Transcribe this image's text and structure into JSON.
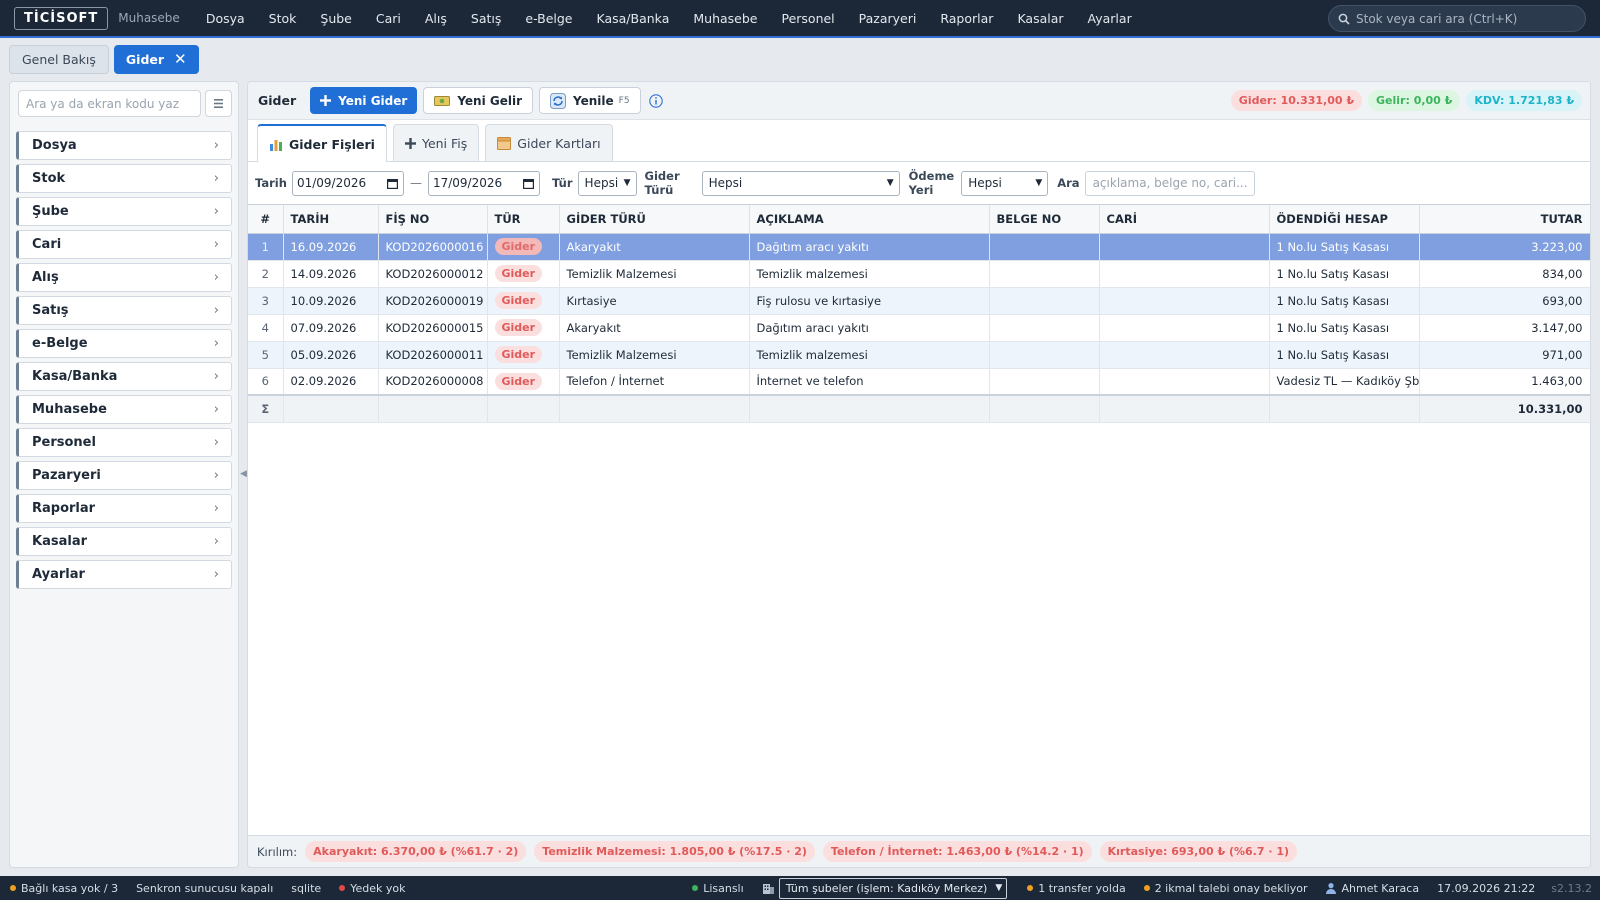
{
  "app": {
    "logo": "TİCİSOFT",
    "logo_sub": "Muhasebe"
  },
  "menu": [
    "Dosya",
    "Stok",
    "Şube",
    "Cari",
    "Alış",
    "Satış",
    "e-Belge",
    "Kasa/Banka",
    "Muhasebe",
    "Personel",
    "Pazaryeri",
    "Raporlar",
    "Kasalar",
    "Ayarlar"
  ],
  "top_search": {
    "placeholder": "Stok veya cari ara (Ctrl+K)"
  },
  "page_tabs": [
    {
      "label": "Genel Bakış"
    },
    {
      "label": "Gider",
      "close": "✕"
    }
  ],
  "sidebar": {
    "search_placeholder": "Ara ya da ekran kodu yaz",
    "items": [
      "Dosya",
      "Stok",
      "Şube",
      "Cari",
      "Alış",
      "Satış",
      "e-Belge",
      "Kasa/Banka",
      "Muhasebe",
      "Personel",
      "Pazaryeri",
      "Raporlar",
      "Kasalar",
      "Ayarlar"
    ]
  },
  "toolbar": {
    "title": "Gider",
    "new_expense": "Yeni Gider",
    "new_income": "Yeni Gelir",
    "refresh": "Yenile",
    "refresh_key": "F5"
  },
  "summary": {
    "expense": "Gider: 10.331,00 ₺",
    "income": "Gelir: 0,00 ₺",
    "vat": "KDV: 1.721,83 ₺"
  },
  "subtabs": [
    "Gider Fişleri",
    "Yeni Fiş",
    "Gider Kartları"
  ],
  "filters": {
    "date_label": "Tarih",
    "date_from": "01/09/2026",
    "date_to": "17/09/2026",
    "type_label": "Tür",
    "type_value": "Hepsi",
    "expense_type_label_1": "Gider",
    "expense_type_label_2": "Türü",
    "expense_type_value": "Hepsi",
    "payment_label_1": "Ödeme",
    "payment_label_2": "Yeri",
    "payment_value": "Hepsi",
    "search_label": "Ara",
    "search_placeholder": "açıklama, belge no, cari..."
  },
  "table": {
    "headers": [
      "#",
      "TARİH",
      "FİŞ NO",
      "TÜR",
      "GİDER TÜRÜ",
      "AÇIKLAMA",
      "BELGE NO",
      "CARİ",
      "ÖDENDİĞİ HESAP",
      "TUTAR"
    ],
    "rows": [
      {
        "n": "1",
        "date": "16.09.2026",
        "no": "KOD2026000016",
        "type": "Gider",
        "kind": "Akaryakıt",
        "desc": "Dağıtım aracı yakıtı",
        "doc": "",
        "cari": "",
        "account": "1 No.lu Satış Kasası",
        "amount": "3.223,00"
      },
      {
        "n": "2",
        "date": "14.09.2026",
        "no": "KOD2026000012",
        "type": "Gider",
        "kind": "Temizlik Malzemesi",
        "desc": "Temizlik malzemesi",
        "doc": "",
        "cari": "",
        "account": "1 No.lu Satış Kasası",
        "amount": "834,00"
      },
      {
        "n": "3",
        "date": "10.09.2026",
        "no": "KOD2026000019",
        "type": "Gider",
        "kind": "Kırtasiye",
        "desc": "Fiş rulosu ve kırtasiye",
        "doc": "",
        "cari": "",
        "account": "1 No.lu Satış Kasası",
        "amount": "693,00"
      },
      {
        "n": "4",
        "date": "07.09.2026",
        "no": "KOD2026000015",
        "type": "Gider",
        "kind": "Akaryakıt",
        "desc": "Dağıtım aracı yakıtı",
        "doc": "",
        "cari": "",
        "account": "1 No.lu Satış Kasası",
        "amount": "3.147,00"
      },
      {
        "n": "5",
        "date": "05.09.2026",
        "no": "KOD2026000011",
        "type": "Gider",
        "kind": "Temizlik Malzemesi",
        "desc": "Temizlik malzemesi",
        "doc": "",
        "cari": "",
        "account": "1 No.lu Satış Kasası",
        "amount": "971,00"
      },
      {
        "n": "6",
        "date": "02.09.2026",
        "no": "KOD2026000008",
        "type": "Gider",
        "kind": "Telefon / İnternet",
        "desc": "İnternet ve telefon",
        "doc": "",
        "cari": "",
        "account": "Vadesiz TL — Kadıköy Şb.",
        "amount": "1.463,00"
      }
    ],
    "total_symbol": "Σ",
    "total_amount": "10.331,00"
  },
  "breakdown": {
    "label": "Kırılım:",
    "items": [
      "Akaryakıt: 6.370,00 ₺ (%61.7 · 2)",
      "Temizlik Malzemesi: 1.805,00 ₺ (%17.5 · 2)",
      "Telefon / İnternet: 1.463,00 ₺ (%14.2 · 1)",
      "Kırtasiye: 693,00 ₺ (%6.7 · 1)"
    ]
  },
  "statusbar": {
    "cash": "Bağlı kasa yok / 3",
    "sync": "Senkron sunucusu kapalı",
    "db": "sqlite",
    "backup": "Yedek yok",
    "license": "Lisanslı",
    "branch": "Tüm şubeler (işlem: Kadıköy Merkez)",
    "transfer": "1 transfer yolda",
    "supply": "2 ikmal talebi onay bekliyor",
    "user": "Ahmet Karaca",
    "datetime": "17.09.2026 21:22",
    "version": "s2.13.2"
  },
  "colors": {
    "accent": "#1f6fd6",
    "topbar": "#1c2838",
    "selected_row": "#7f9fe0",
    "expense_red": "#e05a5a",
    "income_green": "#3bb45b",
    "vat_cyan": "#1fb3c9"
  }
}
